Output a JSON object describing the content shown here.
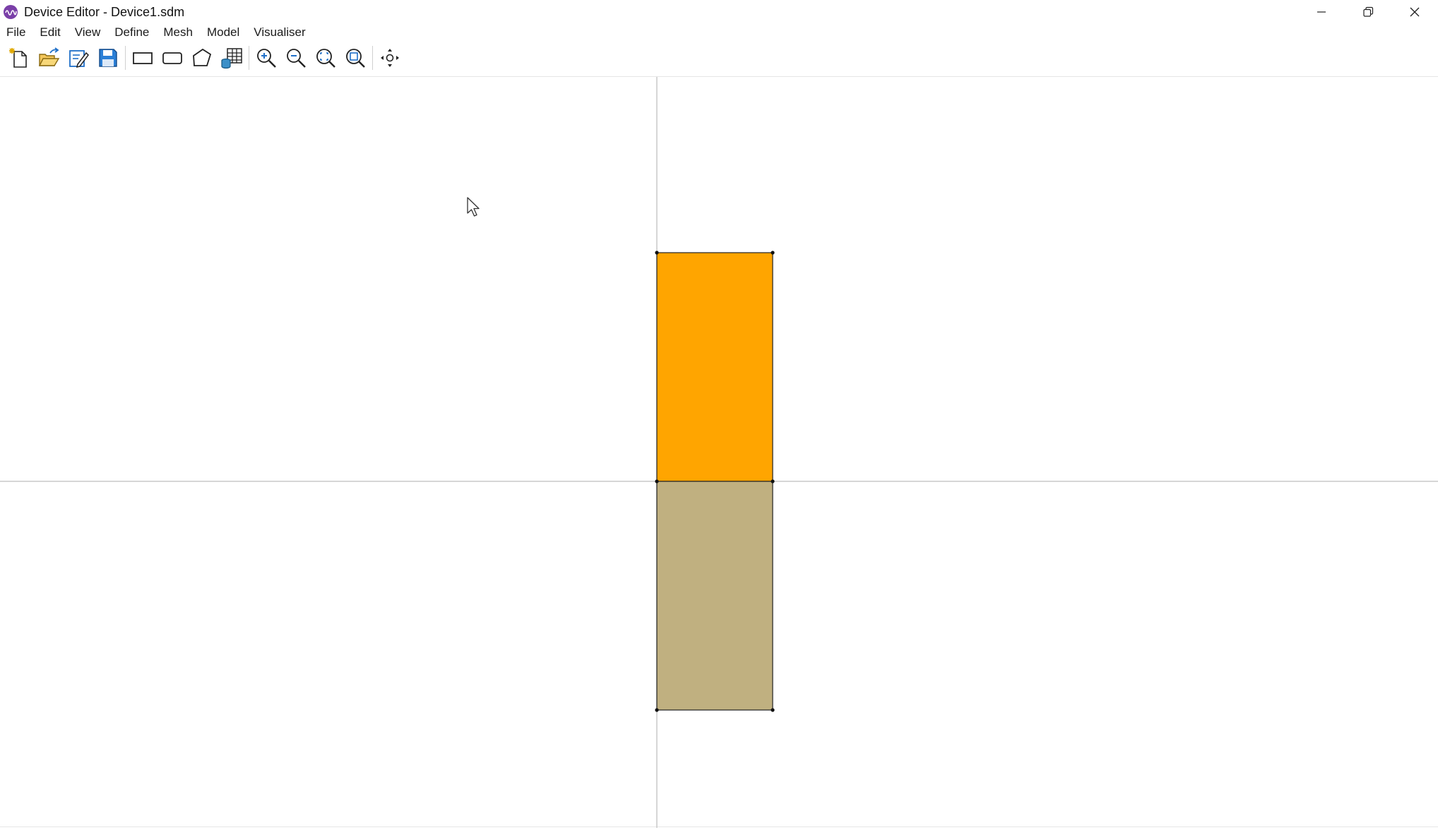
{
  "window": {
    "title": "Device Editor - Device1.sdm",
    "controls": [
      "minimize-icon",
      "restore-icon",
      "close-icon"
    ]
  },
  "menu": {
    "items": [
      "File",
      "Edit",
      "View",
      "Define",
      "Mesh",
      "Model",
      "Visualiser"
    ]
  },
  "toolbar": {
    "groups": [
      [
        "new-file-icon",
        "open-folder-icon",
        "edit-file-icon",
        "save-icon"
      ],
      [
        "rectangle-icon",
        "rounded-rectangle-icon",
        "polygon-icon",
        "material-table-icon"
      ],
      [
        "zoom-in-icon",
        "zoom-out-icon",
        "zoom-fit-icon",
        "zoom-region-icon"
      ],
      [
        "pan-icon"
      ]
    ]
  },
  "colors": {
    "upper_region": "#FFA500",
    "lower_region": "#C0B080",
    "axis": "#c8c8c8",
    "outline": "#222222",
    "accent_icon": "#1f6fc8"
  },
  "canvas": {
    "regions": [
      {
        "name": "upper-region",
        "fill": "#FFA500"
      },
      {
        "name": "lower-region",
        "fill": "#C0B080"
      }
    ]
  }
}
